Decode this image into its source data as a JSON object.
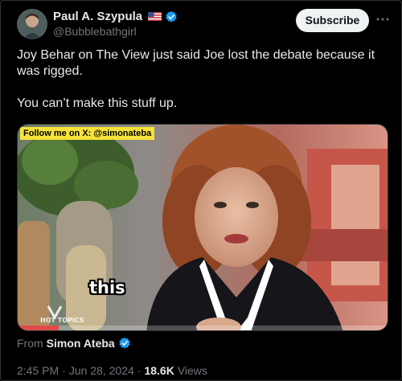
{
  "author": {
    "name": "Paul A. Szypula",
    "handle": "@Bubblebathgirl",
    "flag_icon": "us-flag-icon",
    "verified_icon": "verified-badge-icon"
  },
  "actions": {
    "subscribe_label": "Subscribe",
    "more_icon": "more-horizontal-icon"
  },
  "tweet": {
    "line1": "Joy Behar on The View just said Joe lost the debate because it was rigged.",
    "line2": "You can’t make this stuff up."
  },
  "media": {
    "overlay_label": "Follow me on X: @simonateba",
    "caption": "this",
    "watermark": "HOT TOPICS",
    "progress": 0.11
  },
  "source": {
    "from_label": "From",
    "name": "Simon Ateba",
    "verified_icon": "verified-badge-icon"
  },
  "meta": {
    "time": "2:45 PM",
    "separator": "·",
    "date": "Jun 28, 2024",
    "views_count": "18.6K",
    "views_label": "Views"
  },
  "colors": {
    "background": "#000000",
    "text_primary": "#e7e9ea",
    "text_secondary": "#71767b",
    "verified_blue": "#1d9bf0",
    "overlay_yellow": "#f6e23a",
    "progress_red": "#e24a4a"
  }
}
